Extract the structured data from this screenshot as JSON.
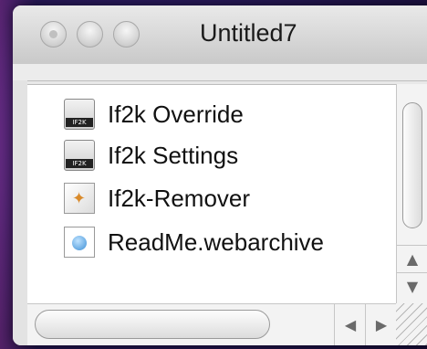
{
  "window": {
    "title": "Untitled7"
  },
  "files": [
    {
      "label": "If2k Override",
      "icon": "package-icon"
    },
    {
      "label": "If2k Settings",
      "icon": "package-icon"
    },
    {
      "label": "If2k-Remover",
      "icon": "app-remover-icon"
    },
    {
      "label": "ReadMe.webarchive",
      "icon": "webarchive-icon"
    }
  ],
  "scroll": {
    "up_glyph": "▲",
    "down_glyph": "▼",
    "left_glyph": "◀",
    "right_glyph": "▶"
  }
}
